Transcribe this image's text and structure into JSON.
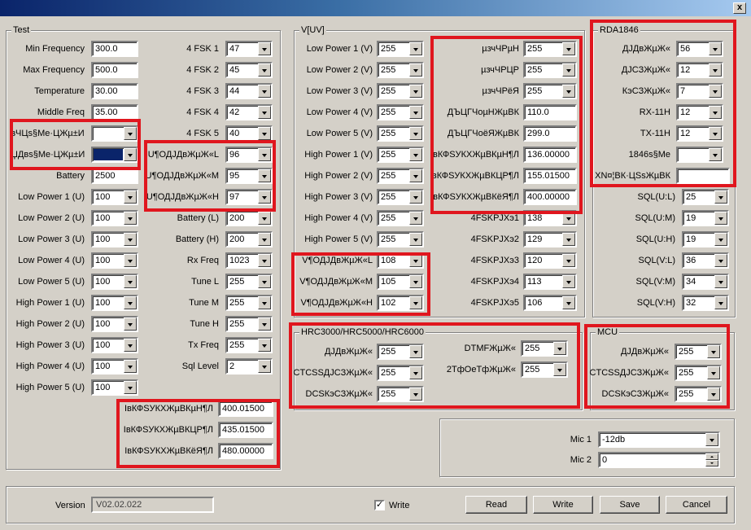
{
  "window": {
    "close_glyph": "x"
  },
  "test": {
    "title": "Test",
    "left_edits": [
      {
        "label": "Min Frequency",
        "value": "300.0"
      },
      {
        "label": "Max Frequency",
        "value": "500.0"
      },
      {
        "label": "Temperature",
        "value": "30.00"
      },
      {
        "label": "Middle Freq",
        "value": "35.00"
      }
    ],
    "garbled_combos": [
      {
        "label": "зЧЦs§Me·ЦЖµ±И",
        "value": ""
      },
      {
        "label": "ЏДвѕ§Me·ЦЖµ±И",
        "value": ""
      }
    ],
    "battery": {
      "label": "Battery",
      "value": "2500"
    },
    "left_combos": [
      {
        "label": "Low Power 1 (U)",
        "value": "100"
      },
      {
        "label": "Low Power 2 (U)",
        "value": "100"
      },
      {
        "label": "Low Power 3 (U)",
        "value": "100"
      },
      {
        "label": "Low Power 4 (U)",
        "value": "100"
      },
      {
        "label": "Low Power 5 (U)",
        "value": "100"
      },
      {
        "label": "High Power 1 (U)",
        "value": "100"
      },
      {
        "label": "High Power 2 (U)",
        "value": "100"
      },
      {
        "label": "High Power 3 (U)",
        "value": "100"
      },
      {
        "label": "High Power 4 (U)",
        "value": "100"
      },
      {
        "label": "High Power 5 (U)",
        "value": "100"
      }
    ],
    "fsk_combos": [
      {
        "label": "4 FSK 1",
        "value": "47"
      },
      {
        "label": "4 FSK 2",
        "value": "45"
      },
      {
        "label": "4 FSK 3",
        "value": "44"
      },
      {
        "label": "4 FSK 4",
        "value": "42"
      },
      {
        "label": "4 FSK 5",
        "value": "40"
      }
    ],
    "u_combos": [
      {
        "label": "U¶ОДЈДвЖµЖ«L",
        "value": "96"
      },
      {
        "label": "U¶ОДЈДвЖµЖ«M",
        "value": "95"
      },
      {
        "label": "U¶ОДЈДвЖµЖ«H",
        "value": "97"
      }
    ],
    "right_combos": [
      {
        "label": "Battery (L)",
        "value": "200"
      },
      {
        "label": "Battery (H)",
        "value": "200"
      },
      {
        "label": "Rx Freq",
        "value": "1023"
      },
      {
        "label": "Tune L",
        "value": "255"
      },
      {
        "label": "Tune M",
        "value": "255"
      },
      {
        "label": "Tune H",
        "value": "255"
      },
      {
        "label": "Tx Freq",
        "value": "255"
      },
      {
        "label": "Sql Level",
        "value": "2"
      }
    ],
    "freq_edits": [
      {
        "label": "ІвКФЅУКХЖµВКµН¶Л",
        "value": "400.01500"
      },
      {
        "label": "ІвКФЅУКХЖµВКЦР¶Л",
        "value": "435.01500"
      },
      {
        "label": "ІвКФЅУКХЖµВКёЯ¶Л",
        "value": "480.00000"
      }
    ]
  },
  "vuv": {
    "title": "V[UV]",
    "low_combos": [
      {
        "label": "Low Power 1 (V)",
        "value": "255"
      },
      {
        "label": "Low Power 2 (V)",
        "value": "255"
      },
      {
        "label": "Low Power 3 (V)",
        "value": "255"
      },
      {
        "label": "Low Power 4 (V)",
        "value": "255"
      },
      {
        "label": "Low Power 5 (V)",
        "value": "255"
      },
      {
        "label": "High Power 1 (V)",
        "value": "255"
      },
      {
        "label": "High Power 2 (V)",
        "value": "255"
      },
      {
        "label": "High Power 3 (V)",
        "value": "255"
      },
      {
        "label": "High Power 4 (V)",
        "value": "255"
      },
      {
        "label": "High Power 5 (V)",
        "value": "255"
      }
    ],
    "v_combos": [
      {
        "label": "V¶ОДЈДвЖµЖ«L",
        "value": "108"
      },
      {
        "label": "V¶ОДЈДвЖµЖ«M",
        "value": "105"
      },
      {
        "label": "V¶ОДЈДвЖµЖ«H",
        "value": "102"
      }
    ],
    "mic_combos": [
      {
        "label": "µзчЧРµН",
        "value": "255"
      },
      {
        "label": "µзчЧРЦР",
        "value": "255"
      },
      {
        "label": "µзчЧРёЯ",
        "value": "255"
      }
    ],
    "range_edits": [
      {
        "label": "ДЪЦГЧоµНЖµВК",
        "value": "110.0"
      },
      {
        "label": "ДЪЦГЧоёЯЖµВК",
        "value": "299.0"
      },
      {
        "label": "вКФЅУКХЖµВКµН¶Л",
        "value": "136.00000"
      },
      {
        "label": "вКФЅУКХЖµВКЦР¶Л",
        "value": "155.01500"
      },
      {
        "label": "вКФЅУКХЖµВКёЯ¶Л",
        "value": "400.00000"
      }
    ],
    "fsk_combos": [
      {
        "label": "4FSKРЈХэ1",
        "value": "138"
      },
      {
        "label": "4FSKРЈХэ2",
        "value": "129"
      },
      {
        "label": "4FSKРЈХэ3",
        "value": "120"
      },
      {
        "label": "4FSKРЈХэ4",
        "value": "113"
      },
      {
        "label": "4FSKРЈХэ5",
        "value": "106"
      }
    ]
  },
  "rda": {
    "title": "RDA1846",
    "combos": [
      {
        "label": "ДЈДвЖµЖ«",
        "value": "56"
      },
      {
        "label": "ДЈСЗЖµЖ«",
        "value": "12"
      },
      {
        "label": "КэСЗЖµЖ«",
        "value": "7"
      },
      {
        "label": "RX-11H",
        "value": "12"
      },
      {
        "label": "TX-11H",
        "value": "12"
      },
      {
        "label": "1846s§Me",
        "value": ""
      }
    ],
    "edit": {
      "label": "XN¤¦ВК·ЦЅsЖµВК",
      "value": ""
    },
    "sql_combos": [
      {
        "label": "SQL(U:L)",
        "value": "25"
      },
      {
        "label": "SQL(U:M)",
        "value": "19"
      },
      {
        "label": "SQL(U:H)",
        "value": "19"
      },
      {
        "label": "SQL(V:L)",
        "value": "36"
      },
      {
        "label": "SQL(V:M)",
        "value": "34"
      },
      {
        "label": "SQL(V:H)",
        "value": "32"
      }
    ]
  },
  "hrc": {
    "title": "HRC3000/HRC5000/HRC6000",
    "left_combos": [
      {
        "label": "ДЈДвЖµЖ«",
        "value": "255"
      },
      {
        "label": "CTCSSДЈСЗЖµЖ«",
        "value": "255"
      },
      {
        "label": "DCSКэСЗЖµЖ«",
        "value": "255"
      }
    ],
    "right_combos": [
      {
        "label": "DTMFЖµЖ«",
        "value": "255"
      },
      {
        "label": "2ТфОеТфЖµЖ«",
        "value": "255"
      }
    ]
  },
  "mcu": {
    "title": "MCU",
    "combos": [
      {
        "label": "ДЈДвЖµЖ«",
        "value": "255"
      },
      {
        "label": "CTCSSДЈСЗЖµЖ«",
        "value": "255"
      },
      {
        "label": "DCSКэСЗЖµЖ«",
        "value": "255"
      }
    ]
  },
  "mic": {
    "mic1": {
      "label": "Mic 1",
      "value": "-12db"
    },
    "mic2": {
      "label": "Mic 2",
      "value": "0"
    }
  },
  "footer": {
    "version_label": "Version",
    "version_value": "V02.02.022",
    "write_check_label": "Write",
    "check_mark": "✓",
    "buttons": {
      "read": "Read",
      "write": "Write",
      "save": "Save",
      "cancel": "Cancel"
    }
  }
}
